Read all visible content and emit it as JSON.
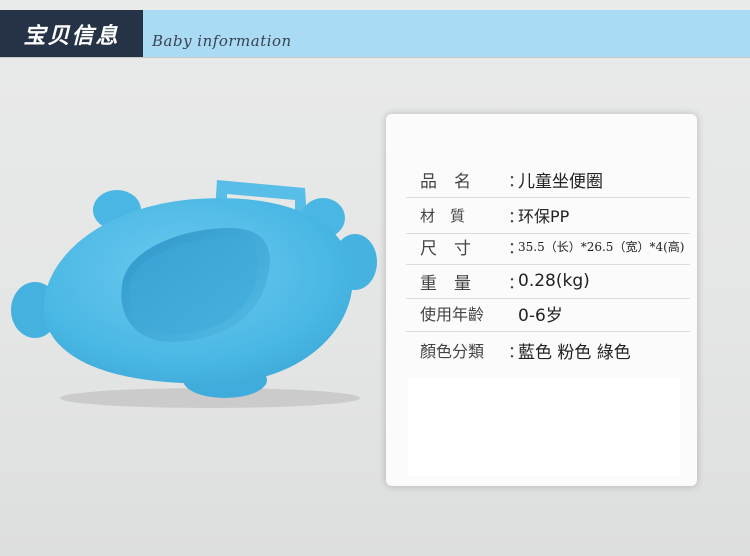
{
  "header": {
    "title": "宝贝信息",
    "subtitle": "Baby information",
    "dark_color": "#263347",
    "light_color": "#a9dcf4"
  },
  "product_image": {
    "name": "potty-seat-image",
    "color": "#4dbde8"
  },
  "specs": [
    {
      "label": "品　名",
      "value": "儿童坐便圈"
    },
    {
      "label": "材　質",
      "value": "环保PP"
    },
    {
      "label": "尺　寸",
      "value": "35.5（长）*26.5（宽）*4(高)"
    },
    {
      "label": "重　量",
      "value": "0.28(kg)"
    },
    {
      "label": "使用年齡",
      "value": "0-6岁"
    },
    {
      "label": "顏色分類",
      "value": "藍色  粉色  綠色"
    }
  ]
}
